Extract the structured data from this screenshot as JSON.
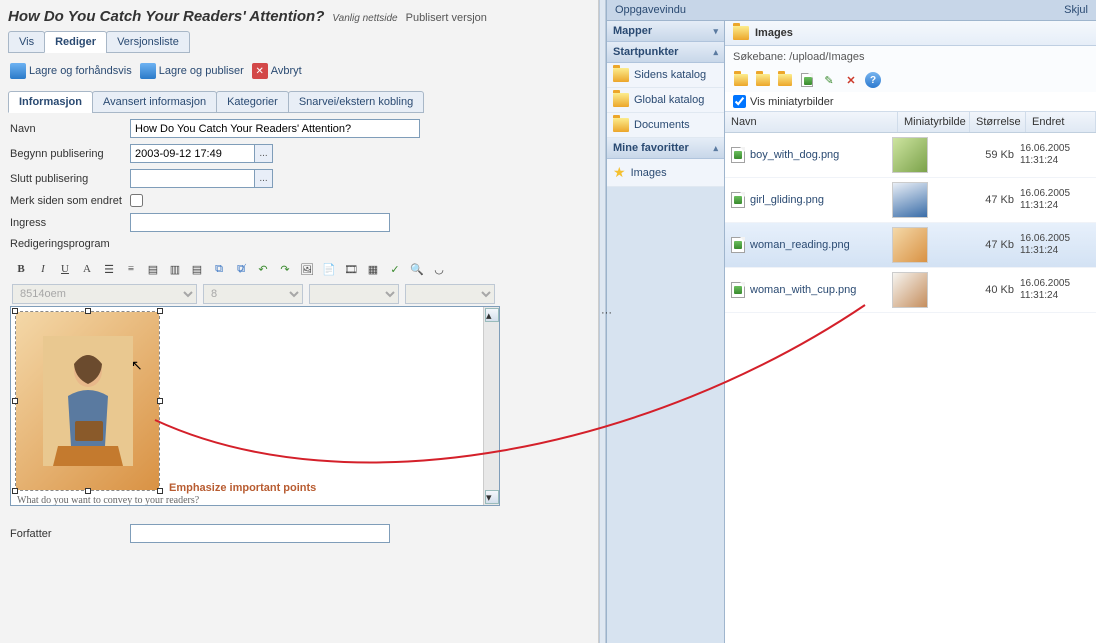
{
  "header": {
    "title": "How Do You Catch Your Readers' Attention?",
    "type_label": "Vanlig nettside",
    "status_label": "Publisert versjon"
  },
  "main_tabs": {
    "view": "Vis",
    "edit": "Rediger",
    "versions": "Versjonsliste"
  },
  "actions": {
    "save_preview": "Lagre og forhåndsvis",
    "save_publish": "Lagre og publiser",
    "cancel": "Avbryt"
  },
  "sub_tabs": {
    "info": "Informasjon",
    "adv": "Avansert informasjon",
    "cats": "Kategorier",
    "shortcut": "Snarvei/ekstern kobling"
  },
  "form": {
    "name_label": "Navn",
    "name_value": "How Do You Catch Your Readers' Attention?",
    "start_label": "Begynn publisering",
    "start_value": "2003-09-12 17:49",
    "end_label": "Slutt publisering",
    "end_value": "",
    "mark_changed_label": "Merk siden som endret",
    "ingress_label": "Ingress",
    "ingress_value": "",
    "editor_label": "Redigeringsprogram",
    "author_label": "Forfatter",
    "author_value": "",
    "pick_btn": "..."
  },
  "editor": {
    "font_name": "8514oem",
    "font_size": "8",
    "heading1": "Emphasize important points",
    "body_text": "What do you want to convey to your readers?"
  },
  "task_panel": {
    "title": "Oppgavevindu",
    "hide": "Skjul"
  },
  "folders": {
    "hdr_mapper": "Mapper",
    "hdr_start": "Startpunkter",
    "hdr_fav": "Mine favoritter",
    "site_catalog": "Sidens katalog",
    "global_catalog": "Global katalog",
    "documents": "Documents",
    "fav_images": "Images"
  },
  "images": {
    "hdr": "Images",
    "path_label": "Søkebane:",
    "path_value": "/upload/Images",
    "show_thumbs": "Vis miniatyrbilder",
    "col_name": "Navn",
    "col_thumb": "Miniatyrbilde",
    "col_size": "Størrelse",
    "col_date": "Endret"
  },
  "files": [
    {
      "name": "boy_with_dog.png",
      "size": "59 Kb",
      "date1": "16.06.2005",
      "date2": "11:31:24",
      "thumb": "linear-gradient(135deg,#cde4a0,#7ba24a)"
    },
    {
      "name": "girl_gliding.png",
      "size": "47 Kb",
      "date1": "16.06.2005",
      "date2": "11:31:24",
      "thumb": "linear-gradient(160deg,#e8eef6,#3a6da8)"
    },
    {
      "name": "woman_reading.png",
      "size": "47 Kb",
      "date1": "16.06.2005",
      "date2": "11:31:24",
      "thumb": "linear-gradient(135deg,#f4d8a8,#d99244)",
      "selected": true
    },
    {
      "name": "woman_with_cup.png",
      "size": "40 Kb",
      "date1": "16.06.2005",
      "date2": "11:31:24",
      "thumb": "linear-gradient(135deg,#f6f4f0,#c58e5e)"
    }
  ]
}
